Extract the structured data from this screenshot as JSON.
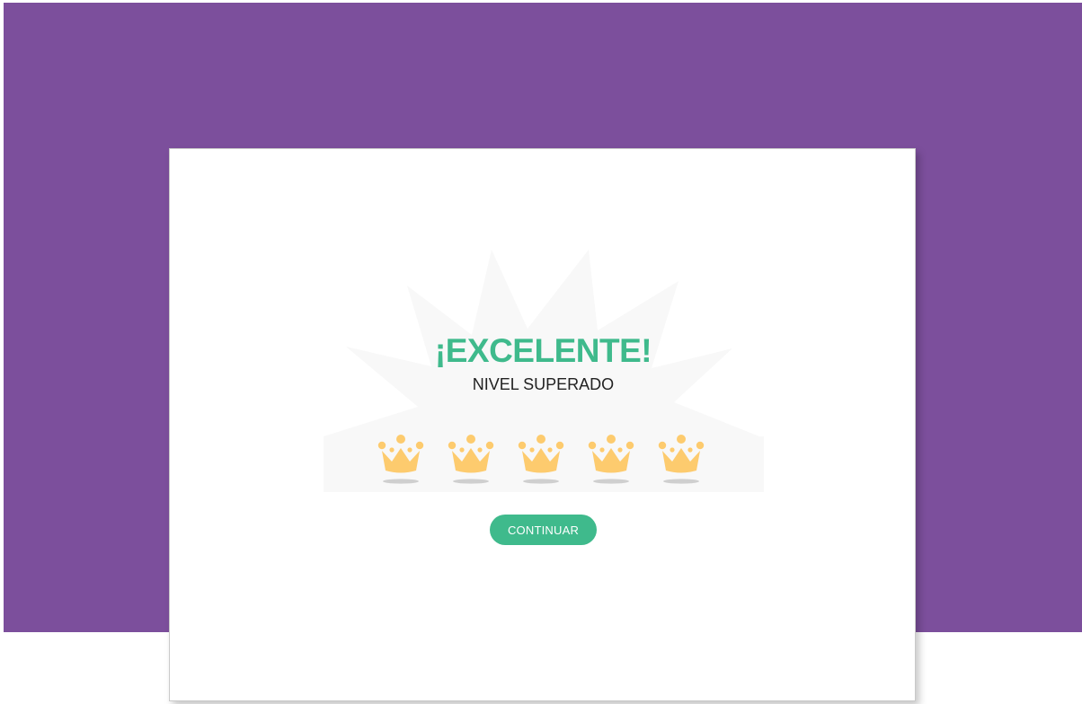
{
  "result": {
    "title": "¡EXCELENTE!",
    "subtitle": "NIVEL SUPERADO"
  },
  "rating": {
    "earned": 5,
    "total": 5,
    "icon": "crown-icon"
  },
  "actions": {
    "continue_label": "CONTINUAR"
  },
  "colors": {
    "background": "#7c4f9c",
    "accent": "#3fba8c",
    "crown": "#fdcb6e",
    "burst": "#f8f8f8"
  }
}
